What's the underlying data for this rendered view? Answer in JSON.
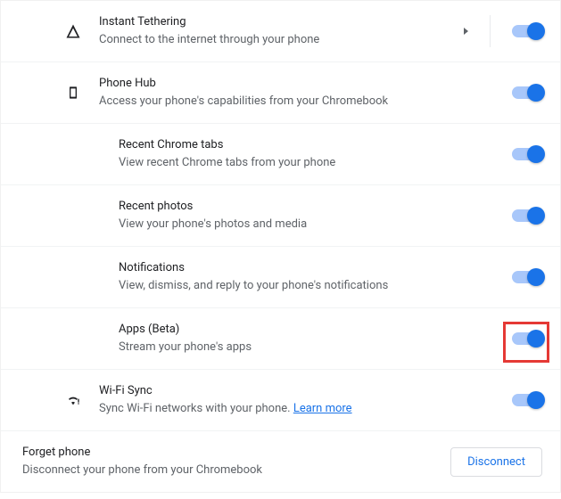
{
  "items": {
    "tethering": {
      "title": "Instant Tethering",
      "desc": "Connect to the internet through your phone"
    },
    "phonehub": {
      "title": "Phone Hub",
      "desc": "Access your phone's capabilities from your Chromebook"
    },
    "tabs": {
      "title": "Recent Chrome tabs",
      "desc": "View recent Chrome tabs from your phone"
    },
    "photos": {
      "title": "Recent photos",
      "desc": "View your phone's photos and media"
    },
    "notifications": {
      "title": "Notifications",
      "desc": "View, dismiss, and reply to your phone's notifications"
    },
    "apps": {
      "title": "Apps (Beta)",
      "desc": "Stream your phone's apps"
    },
    "wifisync": {
      "title": "Wi-Fi Sync",
      "desc": "Sync Wi-Fi networks with your phone. ",
      "learn": "Learn more"
    }
  },
  "footer": {
    "title": "Forget phone",
    "desc": "Disconnect your phone from your Chromebook",
    "button": "Disconnect"
  }
}
